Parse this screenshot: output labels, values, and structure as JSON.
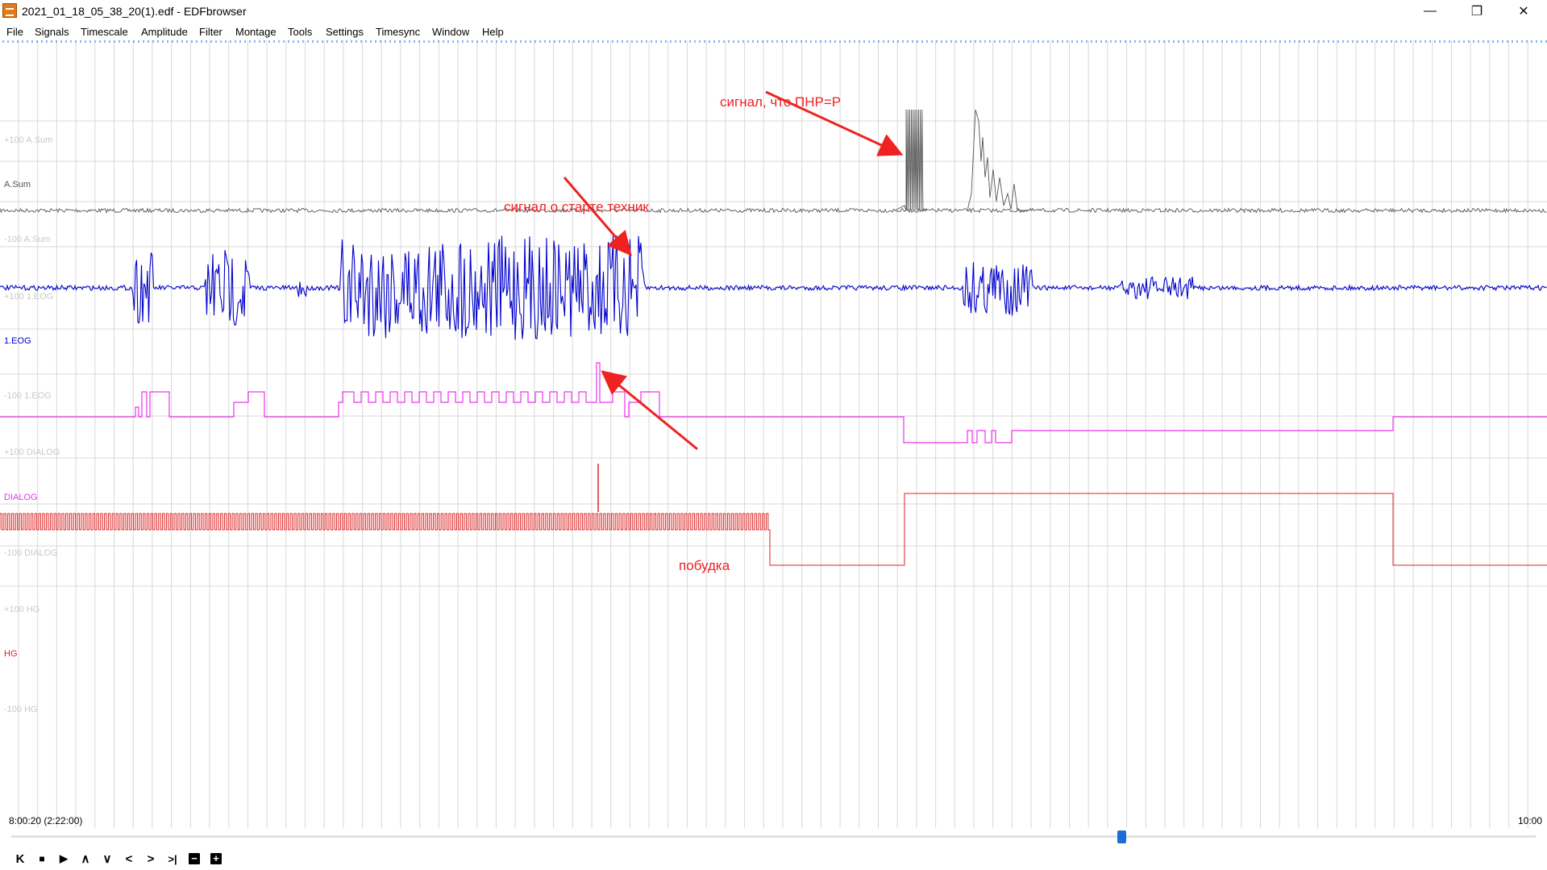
{
  "window": {
    "title": "2021_01_18_05_38_20(1).edf - EDFbrowser",
    "minimize": "—",
    "restore": "❐",
    "close": "✕"
  },
  "menu": [
    "File",
    "Signals",
    "Timescale",
    "Amplitude",
    "Filter",
    "Montage",
    "Tools",
    "Settings",
    "Timesync",
    "Window",
    "Help"
  ],
  "signals": [
    {
      "name": "A.Sum",
      "upper": "+100 A.Sum",
      "lower": "-100 A.Sum",
      "color": "#555555"
    },
    {
      "name": "1.EOG",
      "upper": "+100 1.EOG",
      "lower": "-100 1.EOG",
      "color": "#0000cc"
    },
    {
      "name": "DIALOG",
      "upper": "+100 DIALOG",
      "lower": "-100 DIALOG",
      "color": "#ee33ee"
    },
    {
      "name": "HG",
      "upper": "+100 HG",
      "lower": "-100 HG",
      "color": "#dd2222"
    }
  ],
  "annotations": {
    "pnr": "сигнал, что ПНР=Р",
    "start": "сигнал о старте техник",
    "wake": "побудка"
  },
  "time": {
    "start": "8:00:20 (2:22:00)",
    "end": "10:00"
  },
  "toolbar": {
    "first": "K",
    "stop": "■",
    "play": "▶",
    "up": "∧",
    "down": "∨",
    "prev": "<",
    "next": ">",
    "last": ">|",
    "minus": "−",
    "plus": "+"
  },
  "colors": {
    "grid": "#d8d8d8",
    "annotation": "#ee2222",
    "thumb": "#1a6fd6"
  }
}
